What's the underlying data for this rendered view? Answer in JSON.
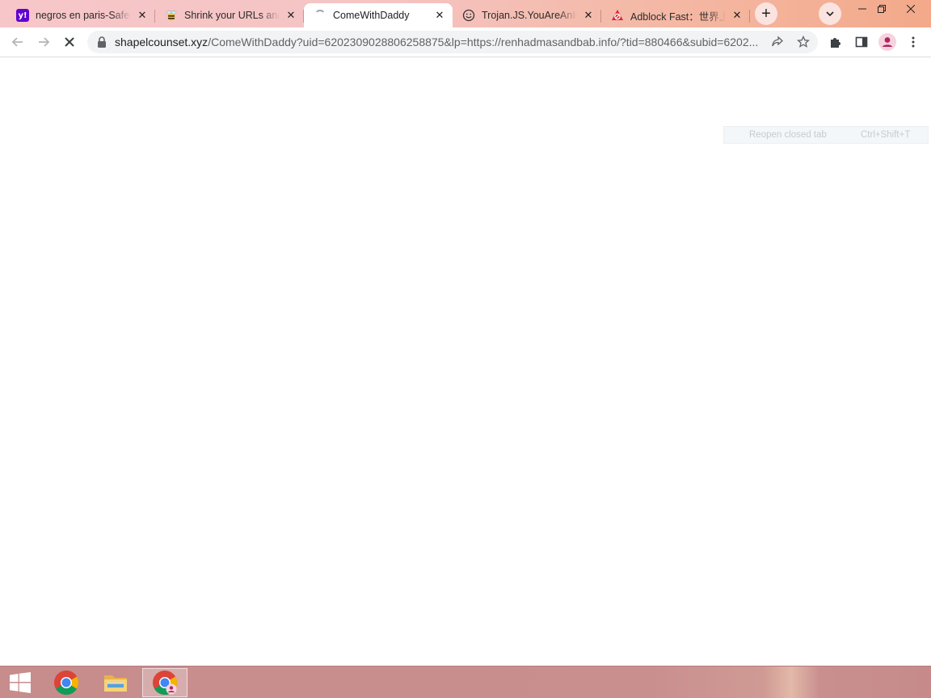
{
  "browser": {
    "tabs": [
      {
        "title": "negros en paris-Saferb",
        "favicon": "yahoo-icon",
        "state": "inactive"
      },
      {
        "title": "Shrink your URLs and get paid",
        "favicon": "bee-icon",
        "state": "inactive"
      },
      {
        "title": "ComeWithDaddy",
        "favicon": "loading-spinner-icon",
        "state": "active"
      },
      {
        "title": "Trojan.JS.YouAreAnIdiot",
        "favicon": "smiley-icon",
        "state": "inactive"
      },
      {
        "title": "Adblock Fast：世界上最快",
        "favicon": "adblock-icon",
        "state": "inactive"
      }
    ],
    "new_tab_label": "+",
    "address_bar": {
      "host": "shapelcounset.xyz",
      "path": "/ComeWithDaddy?uid=6202309028806258875&lp=https://renhadmasandbab.info/?tid=880466&subid=6202..."
    }
  },
  "page": {
    "ghost_menu": {
      "label": "Reopen closed tab",
      "shortcut": "Ctrl+Shift+T"
    }
  },
  "taskbar": {
    "items": [
      "start-button",
      "chrome-taskbar-icon",
      "file-explorer-taskbar-icon",
      "chrome-profile-taskbar-icon"
    ]
  },
  "colors": {
    "tabstrip_start": "#f6c6c9",
    "tabstrip_end": "#f3a98a",
    "taskbar": "#c98f8f",
    "yahoo_purple": "#6001d2",
    "profile_magenta": "#b0255e"
  }
}
